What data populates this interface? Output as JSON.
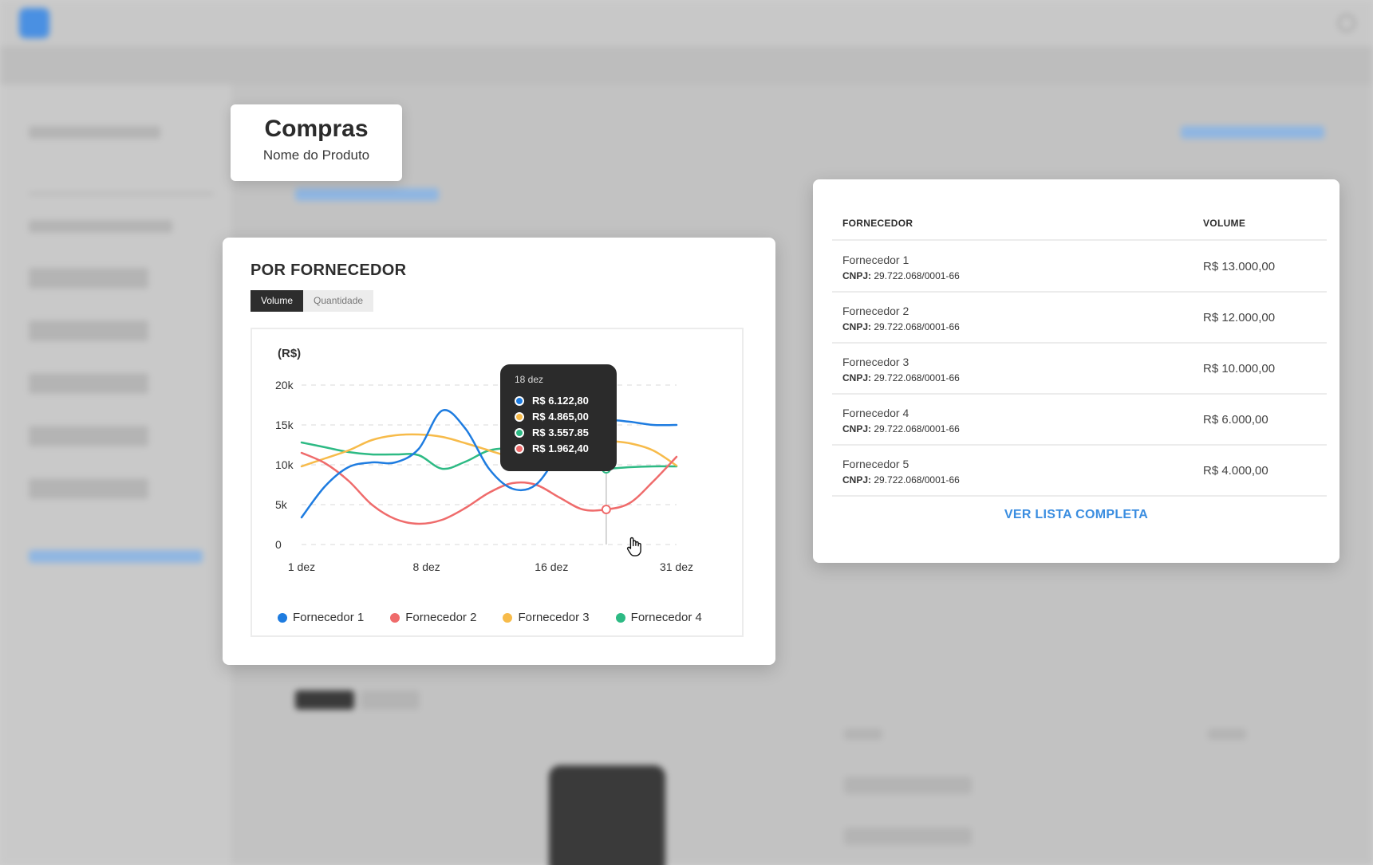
{
  "title_card": {
    "title": "Compras",
    "subtitle": "Nome do Produto"
  },
  "chart_card": {
    "heading": "POR FORNECEDOR",
    "tabs": [
      {
        "label": "Volume",
        "active": true
      },
      {
        "label": "Quantidade",
        "active": false
      }
    ],
    "unit_label": "(R$)",
    "tooltip": {
      "date": "18 dez",
      "entries": [
        {
          "value": "R$ 6.122,80",
          "color": "#1e7ce0"
        },
        {
          "value": "R$ 4.865,00",
          "color": "#f7bb4a"
        },
        {
          "value": "R$ 3.557.85",
          "color": "#2dba84"
        },
        {
          "value": "R$ 1.962,40",
          "color": "#ef6b6b"
        }
      ]
    }
  },
  "chart_data": {
    "type": "line",
    "title": "",
    "xlabel": "",
    "ylabel": "(R$)",
    "x_ticks": [
      "1 dez",
      "8 dez",
      "16 dez",
      "31 dez"
    ],
    "y_ticks": [
      "0",
      "5k",
      "10k",
      "15k",
      "20k"
    ],
    "ylim": [
      0,
      20000
    ],
    "grid": true,
    "legend_position": "bottom",
    "x": [
      0,
      1,
      2,
      3,
      4,
      5,
      6,
      7,
      8,
      9,
      10,
      11,
      12,
      13,
      14,
      15,
      16
    ],
    "series": [
      {
        "name": "Fornecedor 1",
        "color": "#1e7ce0",
        "values": [
          3400,
          7300,
          9700,
          10300,
          10300,
          12000,
          16800,
          14500,
          9500,
          7000,
          7500,
          11500,
          15100,
          15600,
          15400,
          15000,
          15000
        ]
      },
      {
        "name": "Fornecedor 2",
        "color": "#ef6b6b",
        "values": [
          11500,
          10200,
          8000,
          5000,
          3200,
          2600,
          3100,
          4600,
          6500,
          7700,
          7500,
          5900,
          4400,
          4400,
          5200,
          7900,
          11000
        ]
      },
      {
        "name": "Fornecedor 3",
        "color": "#f7bb4a",
        "values": [
          9800,
          10800,
          11800,
          13100,
          13700,
          13800,
          13500,
          12700,
          11800,
          10900,
          10200,
          10800,
          13000,
          13000,
          12700,
          11800,
          9900
        ]
      },
      {
        "name": "Fornecedor 4",
        "color": "#2dba84",
        "values": [
          12800,
          12200,
          11600,
          11300,
          11300,
          11200,
          9500,
          10400,
          11800,
          12000,
          11300,
          10100,
          9500,
          9500,
          9700,
          9800,
          9800
        ]
      }
    ],
    "highlight": {
      "label": "18 dez",
      "x_index": 13
    }
  },
  "table_card": {
    "headers": {
      "supplier": "FORNECEDOR",
      "volume": "VOLUME"
    },
    "cnpj_label": "CNPJ:",
    "rows": [
      {
        "name": "Fornecedor 1",
        "cnpj": "29.722.068/0001-66",
        "volume": "R$ 13.000,00"
      },
      {
        "name": "Fornecedor 2",
        "cnpj": "29.722.068/0001-66",
        "volume": "R$ 12.000,00"
      },
      {
        "name": "Fornecedor 3",
        "cnpj": "29.722.068/0001-66",
        "volume": "R$ 10.000,00"
      },
      {
        "name": "Fornecedor 4",
        "cnpj": "29.722.068/0001-66",
        "volume": "R$ 6.000,00"
      },
      {
        "name": "Fornecedor 5",
        "cnpj": "29.722.068/0001-66",
        "volume": "R$ 4.000,00"
      }
    ],
    "see_all_label": "VER LISTA COMPLETA"
  }
}
